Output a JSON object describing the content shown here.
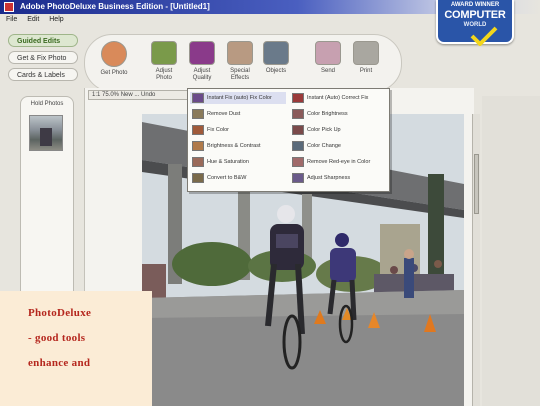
{
  "window": {
    "title": "Adobe PhotoDeluxe Business Edition - [Untitled1]",
    "menu": [
      "File",
      "Edit",
      "Help"
    ]
  },
  "tabs": [
    {
      "label": "Guided Edits",
      "active": true
    },
    {
      "label": "Get & Fix Photo",
      "active": false
    },
    {
      "label": "Cards & Labels",
      "active": false
    }
  ],
  "toolbar": [
    {
      "id": "get-photo",
      "label": "Get Photo",
      "icon": "camera-icon",
      "color": "#d98a5a"
    },
    {
      "id": "adjust",
      "label": "Adjust Photo",
      "icon": "adjust-icon",
      "color": "#7a9a4a"
    },
    {
      "id": "quality",
      "label": "Adjust Quality",
      "icon": "quality-icon",
      "color": "#8a3a8a"
    },
    {
      "id": "effects",
      "label": "Special Effects",
      "icon": "effects-icon",
      "color": "#b89a82"
    },
    {
      "id": "objects",
      "label": "Objects",
      "icon": "objects-icon",
      "color": "#6a7a8a"
    },
    {
      "id": "send",
      "label": "Send",
      "icon": "send-icon",
      "color": "#c7a0b0"
    },
    {
      "id": "print",
      "label": "Print",
      "icon": "print-icon",
      "color": "#a9a7a0"
    }
  ],
  "panel": {
    "header": "Hold Photos"
  },
  "zoom": {
    "label": "1:1  75.0%  New ... Undo"
  },
  "menu": {
    "left": [
      {
        "label": "Instant Fix (auto) Fix Color",
        "color": "#6a4a8a",
        "selected": true
      },
      {
        "label": "Remove Dust",
        "color": "#8a7a5a"
      },
      {
        "label": "Fix Color",
        "color": "#a05a3a"
      },
      {
        "label": "Brightness & Contrast",
        "color": "#b07a4a"
      },
      {
        "label": "Hue & Saturation",
        "color": "#9a6a5a"
      },
      {
        "label": "Convert to B&W",
        "color": "#7a6a4a"
      }
    ],
    "right": [
      {
        "label": "Instant (Auto) Correct Fix",
        "color": "#9a3a3a"
      },
      {
        "label": "Color Brightness",
        "color": "#8a5a5a"
      },
      {
        "label": "Color Pick Up",
        "color": "#7a4a4a"
      },
      {
        "label": "Color Change",
        "color": "#5a6a7a"
      },
      {
        "label": "Remove Red-eye in Color",
        "color": "#a06a6a"
      },
      {
        "label": "Adjust Sharpness",
        "color": "#6a5a8a"
      }
    ]
  },
  "badge": {
    "top": "AWARD WINNER",
    "main": "COMPUTER",
    "sub": "WORLD"
  },
  "caption": {
    "lines": [
      "PhotoDeluxe",
      "- good tools",
      "enhance and"
    ]
  }
}
